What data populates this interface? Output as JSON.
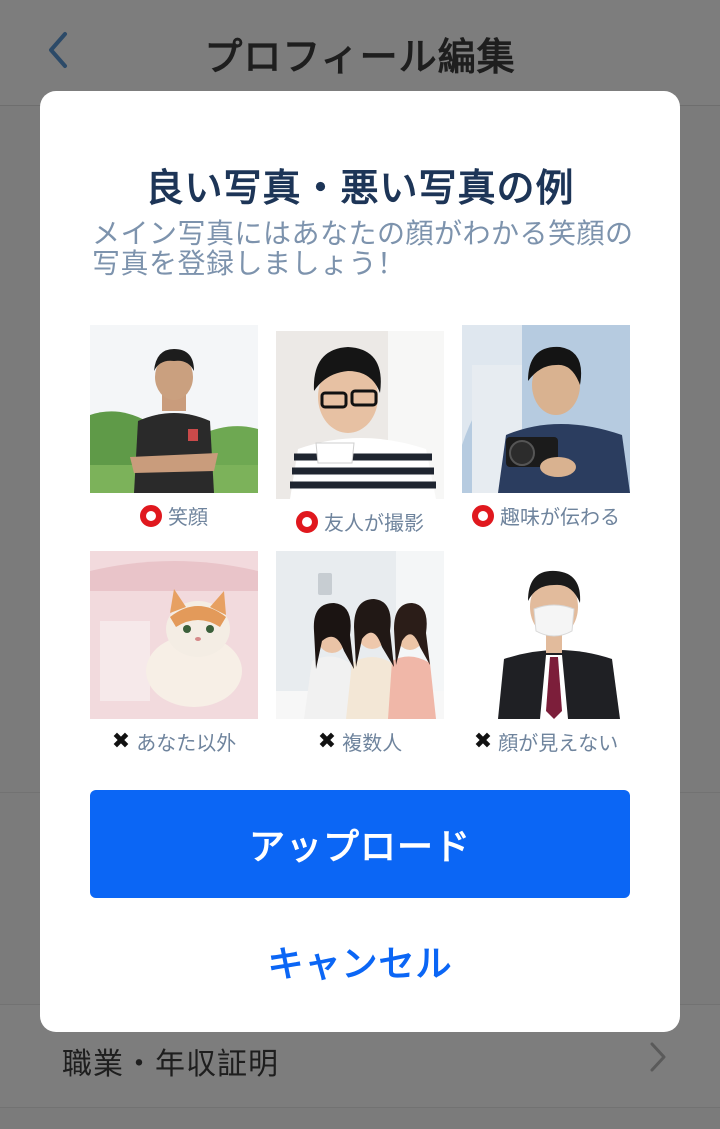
{
  "header": {
    "title": "プロフィール編集",
    "back_icon": "chevron-left-icon"
  },
  "background_list": {
    "visible_item_label": "職業・年収証明",
    "chevron_icon": "chevron-right-icon"
  },
  "modal": {
    "title": "良い写真・悪い写真の例",
    "subtitle": "メイン写真にはあなたの顔がわかる笑顔の写真を登録しましょう！",
    "good_examples": [
      {
        "caption": "笑顔",
        "mark": "circle-ok-icon"
      },
      {
        "caption": "友人が撮影",
        "mark": "circle-ok-icon"
      },
      {
        "caption": "趣味が伝わる",
        "mark": "circle-ok-icon"
      }
    ],
    "bad_examples": [
      {
        "caption": "あなた以外",
        "mark": "cross-ng-icon"
      },
      {
        "caption": "複数人",
        "mark": "cross-ng-icon"
      },
      {
        "caption": "顔が見えない",
        "mark": "cross-ng-icon"
      }
    ],
    "ng_symbol": "✖",
    "upload_label": "アップロード",
    "cancel_label": "キャンセル"
  },
  "colors": {
    "accent_blue": "#0b66f5",
    "title_navy": "#1d3557",
    "subtitle_gray_blue": "#7d93ad",
    "ok_red": "#e0181e",
    "overlay_gray": "#7b7b7b"
  }
}
